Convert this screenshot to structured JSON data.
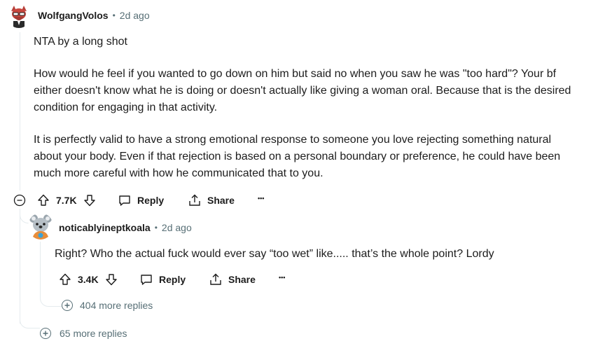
{
  "comment": {
    "username": "WolfgangVolos",
    "time": "2d ago",
    "paragraphs": [
      "NTA by a long shot",
      "How would he feel if you wanted to go down on him but said no when you saw he was \"too hard\"? Your bf either doesn't know what he is doing or doesn't actually like giving a woman oral. Because that is the desired condition for engaging in that activity.",
      "It is perfectly valid to have a strong emotional response to someone you love rejecting something natural about your body. Even if that rejection is based on a personal boundary or preference, he could have been much more careful with how he communicated that to you."
    ],
    "votes": "7.7K",
    "reply_label": "Reply",
    "share_label": "Share",
    "more_label": "•••",
    "more_replies": "65 more replies"
  },
  "reply": {
    "username": "noticablyineptkoala",
    "time": "2d ago",
    "text": "Right? Who the actual fuck would ever say “too wet” like..... that’s the whole point? Lordy",
    "votes": "3.4K",
    "reply_label": "Reply",
    "share_label": "Share",
    "more_label": "•••",
    "more_replies": "404 more replies"
  },
  "colors": {
    "text": "#1c1c1c",
    "meta": "#576f76",
    "thread_line": "#e5ebee"
  },
  "icons": [
    "collapse-icon",
    "upvote-icon",
    "downvote-icon",
    "reply-icon",
    "share-icon",
    "more-options-icon",
    "expand-replies-icon"
  ]
}
